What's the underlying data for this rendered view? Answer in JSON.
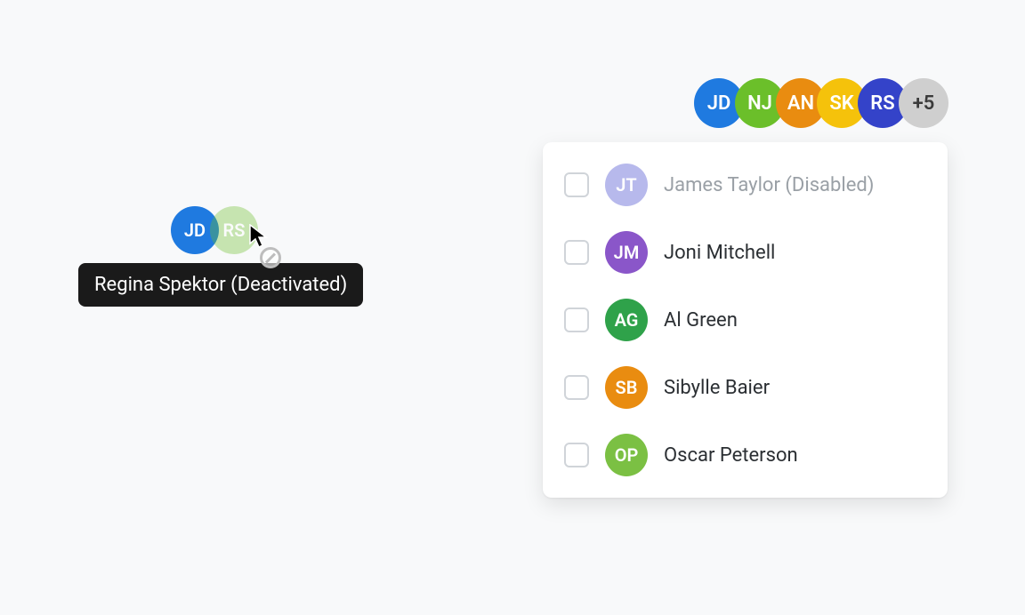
{
  "colors": {
    "blue": "#1f7ae0",
    "green": "#6bbf2a",
    "orange": "#e98c10",
    "yellow": "#f5c20b",
    "indigo": "#3443c9",
    "grey": "#cfcfcf",
    "lavender": "#b7b9ec",
    "purple": "#8a56c9",
    "deepgreen": "#2fa24a",
    "deeporange": "#e98c10",
    "lime": "#7bc043"
  },
  "left_stack": {
    "avatars": [
      {
        "initials": "JD",
        "colorKey": "blue",
        "faded": false
      },
      {
        "initials": "RS",
        "colorKey": "green",
        "faded": true
      }
    ]
  },
  "tooltip": {
    "text": "Regina Spektor (Deactivated)"
  },
  "avatar_row": [
    {
      "initials": "JD",
      "colorKey": "blue"
    },
    {
      "initials": "NJ",
      "colorKey": "green"
    },
    {
      "initials": "AN",
      "colorKey": "orange"
    },
    {
      "initials": "SK",
      "colorKey": "yellow"
    },
    {
      "initials": "RS",
      "colorKey": "indigo"
    }
  ],
  "avatar_row_overflow": "+5",
  "panel": {
    "rows": [
      {
        "initials": "JT",
        "name": "James Taylor (Disabled)",
        "colorKey": "lavender",
        "disabled": true
      },
      {
        "initials": "JM",
        "name": "Joni Mitchell",
        "colorKey": "purple",
        "disabled": false
      },
      {
        "initials": "AG",
        "name": "Al Green",
        "colorKey": "deepgreen",
        "disabled": false
      },
      {
        "initials": "SB",
        "name": "Sibylle Baier",
        "colorKey": "deeporange",
        "disabled": false
      },
      {
        "initials": "OP",
        "name": "Oscar Peterson",
        "colorKey": "lime",
        "disabled": false
      }
    ]
  }
}
